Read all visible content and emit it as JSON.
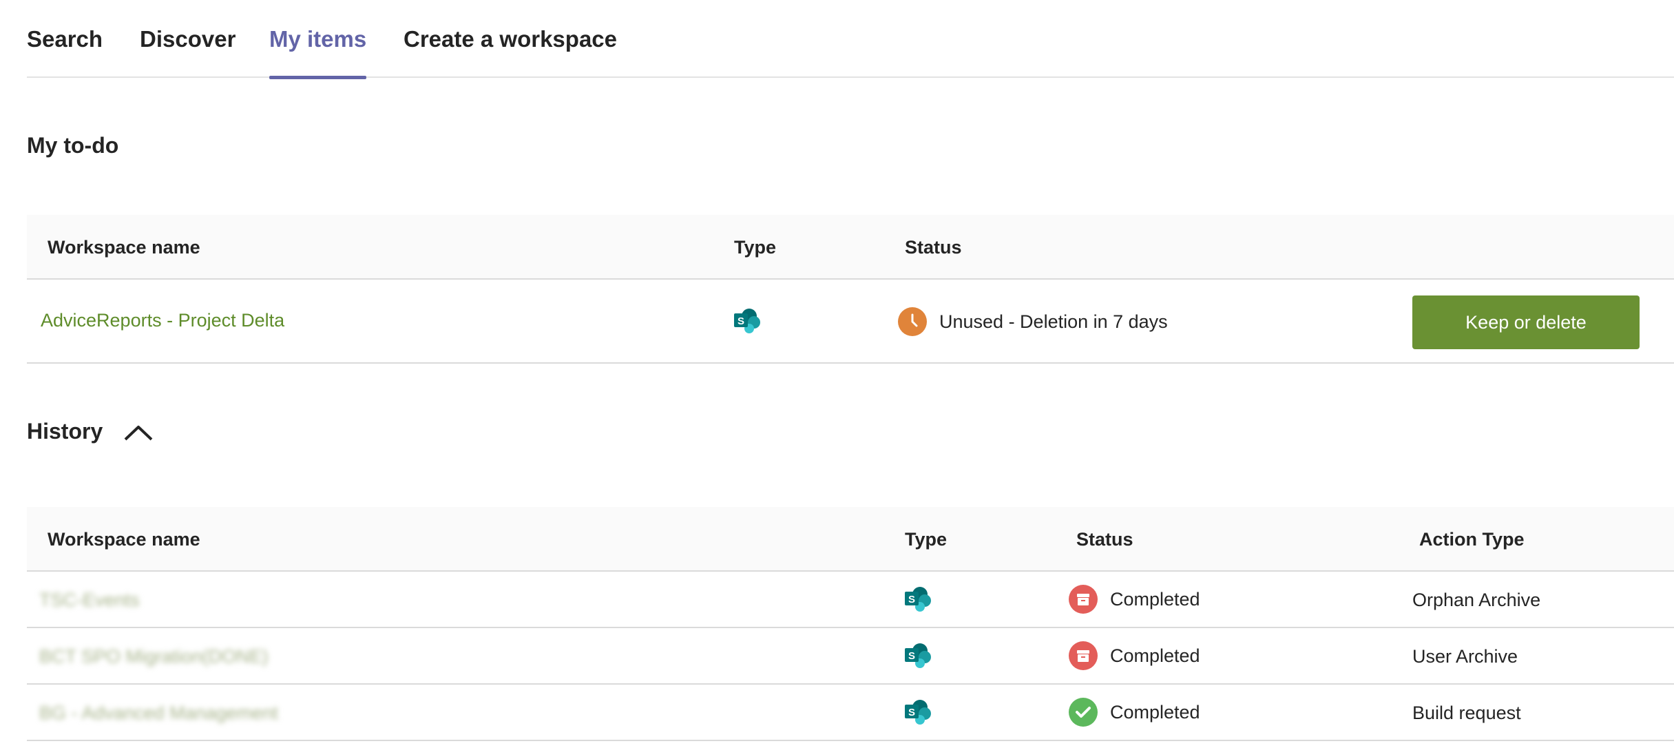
{
  "tabs": [
    {
      "label": "Search",
      "active": false
    },
    {
      "label": "Discover",
      "active": false
    },
    {
      "label": "My items",
      "active": true
    },
    {
      "label": "Create a workspace",
      "active": false
    }
  ],
  "todo": {
    "title": "My to-do",
    "columns": [
      "Workspace name",
      "Type",
      "Status"
    ],
    "rows": [
      {
        "name": "AdviceReports - Project Delta",
        "type_icon": "sharepoint-icon",
        "status_icon": "clock-icon",
        "status": "Unused - Deletion in 7 days",
        "action_label": "Keep or delete"
      }
    ]
  },
  "history": {
    "title": "History",
    "toggle_icon": "chevron-up-icon",
    "columns": [
      "Workspace name",
      "Type",
      "Status",
      "Action Type"
    ],
    "rows": [
      {
        "name": "TSC-Events",
        "type_icon": "sharepoint-icon",
        "status_icon": "archive-icon",
        "status": "Completed",
        "action_type": "Orphan Archive"
      },
      {
        "name": "BCT SPO Migration(DONE)",
        "type_icon": "sharepoint-icon",
        "status_icon": "archive-icon",
        "status": "Completed",
        "action_type": "User Archive"
      },
      {
        "name": "BG - Advanced Management",
        "type_icon": "sharepoint-icon",
        "status_icon": "check-icon",
        "status": "Completed",
        "action_type": "Build request"
      }
    ]
  },
  "colors": {
    "accent": "#6264a7",
    "link_green": "#5e8c2a",
    "button_green": "#6a9133",
    "clock_orange": "#e0843a",
    "archive_red": "#e35d59",
    "check_green": "#5cb85c",
    "sharepoint_teal": "#036c70"
  }
}
